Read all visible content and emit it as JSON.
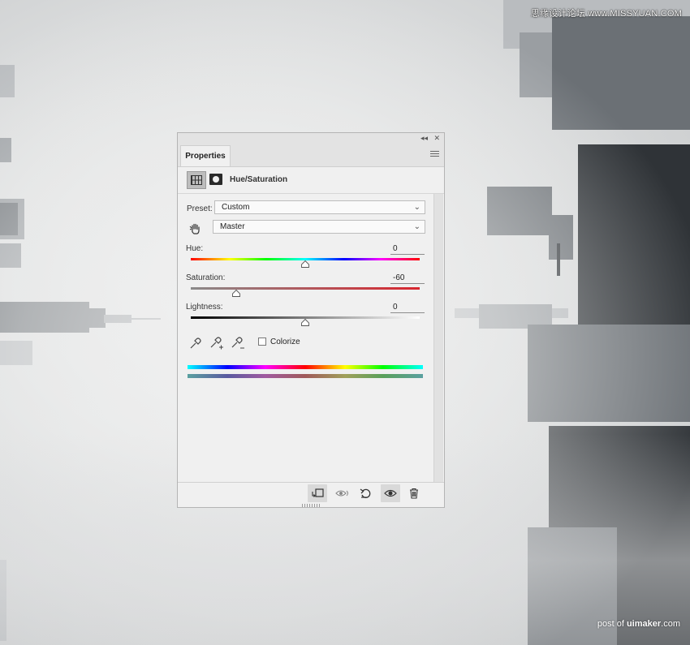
{
  "watermarks": {
    "top": "思缘设计论坛 www.MISSYUAN.COM",
    "bottom_prefix": "post of ",
    "bottom_brand": "uimaker",
    "bottom_suffix": ".com"
  },
  "panel": {
    "tab_label": "Properties",
    "collapse_glyph": "◂◂",
    "close_glyph": "✕",
    "menu_icon": "panel-menu-icon",
    "title": "Hue/Saturation",
    "preset_label": "Preset:",
    "preset_value": "Custom",
    "channel_value": "Master",
    "hue": {
      "label": "Hue:",
      "value": "0",
      "position": 0.5
    },
    "saturation": {
      "label": "Saturation:",
      "value": "-60",
      "position": 0.2
    },
    "lightness": {
      "label": "Lightness:",
      "value": "0",
      "position": 0.5
    },
    "colorize_label": "Colorize",
    "colorize_checked": false,
    "footer_icons": [
      "clip-to-layer-icon",
      "view-previous-icon",
      "reset-icon",
      "visibility-icon",
      "trash-icon"
    ]
  },
  "colors": {
    "panel_bg": "#f0f0f0",
    "accent_red": "#d8262f"
  }
}
